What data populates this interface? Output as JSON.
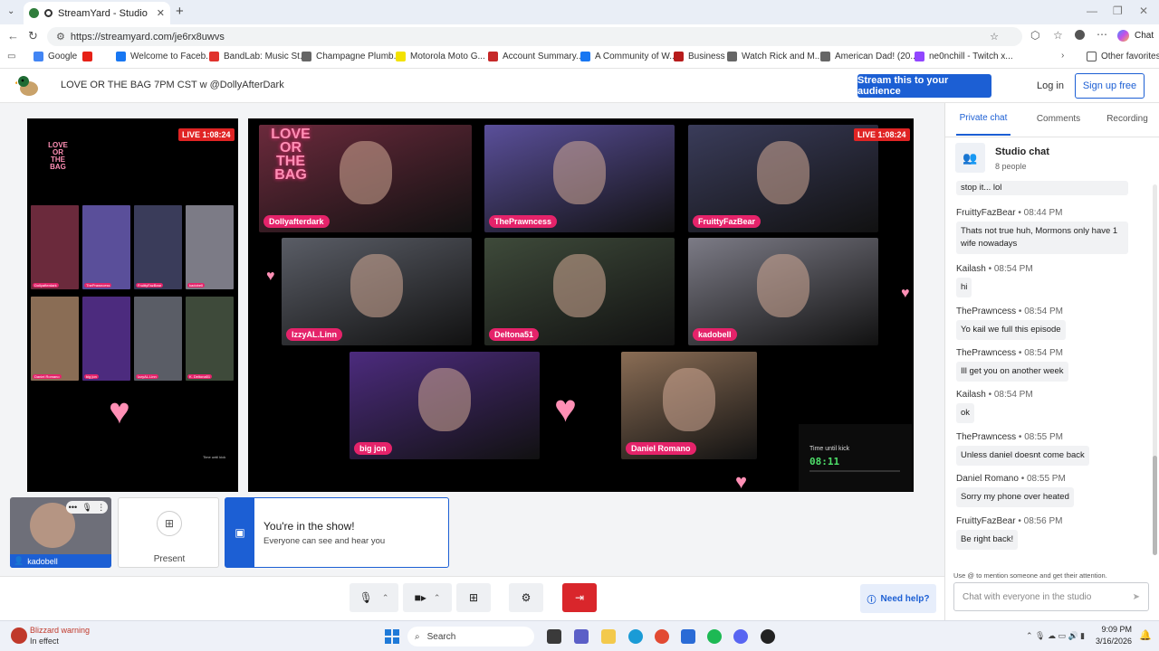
{
  "browser": {
    "tab_title": "StreamYard - Studio",
    "url": "https://streamyard.com/je6rx8uwvs",
    "chat_button": "Chat",
    "bookmarks": [
      {
        "label": "Google",
        "color": "#4285f4"
      },
      {
        "label": "",
        "color": "#e62117"
      },
      {
        "label": "Welcome to Faceb...",
        "color": "#1877f2"
      },
      {
        "label": "BandLab: Music St...",
        "color": "#e0322c"
      },
      {
        "label": "Champagne Plumb...",
        "color": "#666666"
      },
      {
        "label": "Motorola Moto G...",
        "color": "#f3e200"
      },
      {
        "label": "Account Summary...",
        "color": "#c62828"
      },
      {
        "label": "A Community of W...",
        "color": "#1877f2"
      },
      {
        "label": "Business",
        "color": "#b71c1c"
      },
      {
        "label": "Watch Rick and M...",
        "color": "#666666"
      },
      {
        "label": "American Dad! (20...",
        "color": "#666666"
      },
      {
        "label": "ne0nchill - Twitch x...",
        "color": "#9146ff"
      }
    ],
    "other_favorites": "Other favorites"
  },
  "header": {
    "title": "LOVE OR THE BAG 7PM CST w @DollyAfterDark",
    "stream_button": "Stream this to your audience",
    "login": "Log in",
    "signup": "Sign up free"
  },
  "preview": {
    "live_badge": "LIVE 1:08:24",
    "logo_text": "LOVE OR THE BAG",
    "mini_names": [
      "Dollyafterdark",
      "ThePrawncess",
      "FruittyFazBear",
      "kadobell",
      "Daniel Romano",
      "big jon",
      "IzzyAL.Linn",
      "K. Deltona51"
    ],
    "timer_label": "Time until kick"
  },
  "stage": {
    "live_badge": "LIVE 1:08:24",
    "logo_text": "LOVE OR THE BAG",
    "participants": [
      {
        "name": "Dollyafterdark",
        "color": "#6b2a3c"
      },
      {
        "name": "ThePrawncess",
        "color": "#5a4f9a"
      },
      {
        "name": "FruittyFazBear",
        "color": "#3a3c5a"
      },
      {
        "name": "IzzyAL.Linn",
        "color": "#5a5d66"
      },
      {
        "name": "Deltona51",
        "color": "#3e4a3a"
      },
      {
        "name": "kadobell",
        "color": "#7c7b86"
      },
      {
        "name": "big jon",
        "color": "#4c2b7e"
      },
      {
        "name": "Daniel Romano",
        "color": "#8a6d55"
      }
    ],
    "timer_label": "Time until kick",
    "timer_value": "08:11"
  },
  "self_tile": {
    "name": "kadobell"
  },
  "present": {
    "label": "Present"
  },
  "inshow": {
    "title": "You're in the show!",
    "subtitle": "Everyone can see and hear you"
  },
  "help": "Need help?",
  "panel": {
    "tabs": [
      "Private chat",
      "Comments",
      "Recording"
    ],
    "studio_chat": "Studio chat",
    "people": "8 people",
    "first_partial": "stop it... lol",
    "messages": [
      {
        "name": "FruittyFazBear",
        "time": "08:44 PM",
        "text": "Thats not true huh, Mormons only have 1 wife nowadays"
      },
      {
        "name": "Kailash",
        "time": "08:54 PM",
        "text": "hi"
      },
      {
        "name": "ThePrawncess",
        "time": "08:54 PM",
        "text": "Yo kail we full this episode"
      },
      {
        "name": "ThePrawncess",
        "time": "08:54 PM",
        "text": "Ill get you on another week"
      },
      {
        "name": "Kailash",
        "time": "08:54 PM",
        "text": "ok"
      },
      {
        "name": "ThePrawncess",
        "time": "08:55 PM",
        "text": "Unless daniel doesnt come back"
      },
      {
        "name": "Daniel Romano",
        "time": "08:55 PM",
        "text": "Sorry my phone over heated"
      },
      {
        "name": "FruittyFazBear",
        "time": "08:56 PM",
        "text": "Be right back!"
      }
    ],
    "hint": "Use @ to mention someone and get their attention.",
    "placeholder": "Chat with everyone in the studio"
  },
  "taskbar": {
    "warning_title": "Blizzard warning",
    "warning_sub": "In effect",
    "search": "Search",
    "time": "9:09 PM",
    "date": "3/16/2026"
  }
}
